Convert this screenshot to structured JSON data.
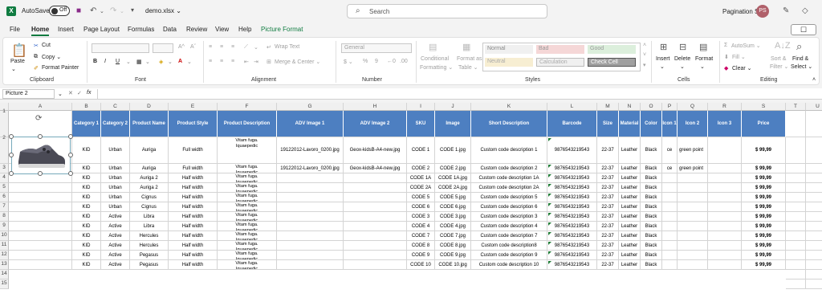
{
  "titlebar": {
    "autosave_label": "AutoSave",
    "autosave_state": "Off",
    "filename": "demo.xlsx ⌄",
    "search_placeholder": "Search",
    "org": "Pagination Srl",
    "avatar": "PS"
  },
  "menu": [
    "File",
    "Home",
    "Insert",
    "Page Layout",
    "Formulas",
    "Data",
    "Review",
    "View",
    "Help",
    "Picture Format"
  ],
  "ribbon": {
    "clipboard": {
      "paste": "Paste",
      "cut": "Cut",
      "copy": "Copy ⌄",
      "format_painter": "Format Painter",
      "label": "Clipboard"
    },
    "font": {
      "label": "Font"
    },
    "alignment": {
      "wrap": "Wrap Text",
      "merge": "Merge & Center ⌄",
      "label": "Alignment"
    },
    "number": {
      "format": "General",
      "label": "Number"
    },
    "styles": {
      "conditional": "Conditional",
      "formatting": "Formatting ⌄",
      "format_as": "Format as",
      "table": "Table ⌄",
      "normal": "Normal",
      "bad": "Bad",
      "good": "Good",
      "neutral": "Neutral",
      "calculation": "Calculation",
      "check": "Check Cell",
      "label": "Styles"
    },
    "cells": {
      "insert": "Insert",
      "delete": "Delete",
      "format": "Format",
      "label": "Cells"
    },
    "editing": {
      "autosum": "AutoSum ⌄",
      "fill": "Fill ⌄",
      "clear": "Clear ⌄",
      "sort": "Sort &",
      "filter": "Filter ⌄",
      "find": "Find &",
      "select": "Select ⌄",
      "label": "Editing"
    }
  },
  "formula_bar": {
    "name_box": "Picture 2",
    "fx": "fx"
  },
  "columns": [
    "A",
    "B",
    "C",
    "D",
    "E",
    "F",
    "G",
    "H",
    "I",
    "J",
    "K",
    "L",
    "M",
    "N",
    "O",
    "P",
    "Q",
    "R",
    "S",
    "T",
    "U"
  ],
  "rows": [
    "1",
    "2",
    "3",
    "4",
    "5",
    "6",
    "7",
    "8",
    "9",
    "10",
    "11",
    "12",
    "13",
    "14",
    "15"
  ],
  "header_row": [
    "",
    "Category 1",
    "Category 2",
    "Product Name",
    "Product Style",
    "Product Description",
    "ADV Image 1",
    "ADV Image 2",
    "SKU",
    "Image",
    "Short Description",
    "Barcode",
    "Size",
    "Material",
    "Color",
    "Icon 1",
    "Icon 2",
    "Icon 3",
    "Price"
  ],
  "data_rows": [
    [
      "",
      "KID",
      "Urban",
      "Auriga",
      "Full width",
      "Vitam fuga.\nIquaepedic",
      "19122012-Lavoro_0200.jpg",
      "Geox-kidsB-A4-new.jpg",
      "CODE 1",
      "CODE 1.jpg",
      "Custom code description 1",
      "9876543219543",
      "22-37",
      "Leather",
      "Black",
      "ce",
      "green point",
      "",
      "$ 99,99"
    ],
    [
      "",
      "KID",
      "Urban",
      "Auriga",
      "Full width",
      "Vitam fuga.\nIquaepedic\n<b>torem</b> <i>\nincium eum <i>con</i>\nplaborrum Labo.\n<ul><li> Ristia quid",
      "19122012-Lavoro_0200.jpg",
      "Geox-kidsB-A4-new.jpg",
      "CODE 2",
      "CODE 2.jpg",
      "Custom code description 2",
      "9876543219543",
      "22-37",
      "Leather",
      "Black",
      "ce",
      "green point",
      "",
      "$ 99,99"
    ],
    [
      "",
      "KID",
      "Urban",
      "Auriga 2",
      "Half width",
      "Vitam fuga.\nIquaepedic",
      "",
      "",
      "CODE 1A",
      "CODE 1A.jpg",
      "Custom code description 1A",
      "9876543219543",
      "22-37",
      "Leather",
      "Black",
      "",
      "",
      "",
      "$ 99,99"
    ],
    [
      "",
      "KID",
      "Urban",
      "Auriga 2",
      "Half width",
      "Vitam fuga.\nIquaepedic",
      "",
      "",
      "CODE 2A",
      "CODE 2A.jpg",
      "Custom code description 2A",
      "9876543219543",
      "22-37",
      "Leather",
      "Black",
      "",
      "",
      "",
      "$ 99,99"
    ],
    [
      "",
      "KID",
      "Urban",
      "Cignus",
      "Half width",
      "Vitam fuga.\nIquaepedic",
      "",
      "",
      "CODE 5",
      "CODE 5.jpg",
      "Custom code description 5",
      "9876543219543",
      "22-37",
      "Leather",
      "Black",
      "",
      "",
      "",
      "$ 99,99"
    ],
    [
      "",
      "KID",
      "Urban",
      "Cignus",
      "Half width",
      "Vitam fuga.\nIquaepedic",
      "",
      "",
      "CODE 6",
      "CODE 6.jpg",
      "Custom code description 6",
      "9876543219543",
      "22-37",
      "Leather",
      "Black",
      "",
      "",
      "",
      "$ 99,99"
    ],
    [
      "",
      "KID",
      "Active",
      "Libra",
      "Half width",
      "Vitam fuga.\nIquaepedic",
      "",
      "",
      "CODE 3",
      "CODE 3.jpg",
      "Custom code description 3",
      "9876543219543",
      "22-37",
      "Leather",
      "Black",
      "",
      "",
      "",
      "$ 99,99"
    ],
    [
      "",
      "KID",
      "Active",
      "Libra",
      "Half width",
      "Vitam fuga.\nIquaepedic",
      "",
      "",
      "CODE 4",
      "CODE 4.jpg",
      "Custom code description 4",
      "9876543219543",
      "22-37",
      "Leather",
      "Black",
      "",
      "",
      "",
      "$ 99,99"
    ],
    [
      "",
      "KID",
      "Active",
      "Hercules",
      "Half width",
      "Vitam fuga.\nIquaepedic",
      "",
      "",
      "CODE 7",
      "CODE 7.jpg",
      "Custom code description 7",
      "9876543219543",
      "22-37",
      "Leather",
      "Black",
      "",
      "",
      "",
      "$ 99,99"
    ],
    [
      "",
      "KID",
      "Active",
      "Hercules",
      "Half width",
      "Vitam fuga.\nIquaepedic",
      "",
      "",
      "CODE 8",
      "CODE 8.jpg",
      "Custom code description8",
      "9876543219543",
      "22-37",
      "Leather",
      "Black",
      "",
      "",
      "",
      "$ 99,99"
    ],
    [
      "",
      "KID",
      "Active",
      "Pegasus",
      "Half width",
      "Vitam fuga.\nIquaepedic",
      "",
      "",
      "CODE 9",
      "CODE 9.jpg",
      "Custom code description 9",
      "9876543219543",
      "22-37",
      "Leather",
      "Black",
      "",
      "",
      "",
      "$ 99,99"
    ],
    [
      "",
      "KID",
      "Active",
      "Pegasus",
      "Half width",
      "Vitam fuga.\nIquaepedic",
      "",
      "",
      "CODE 10",
      "CODE 10.jpg",
      "Custom code description 10",
      "9876543219543",
      "22-37",
      "Leather",
      "Black",
      "",
      "",
      "",
      "$ 99,99"
    ]
  ],
  "colors": {
    "excel_green": "#107c41",
    "header_blue": "#4d7fc1"
  }
}
